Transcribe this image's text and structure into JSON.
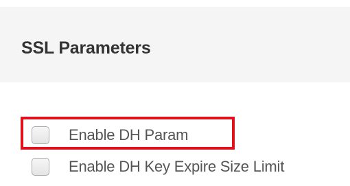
{
  "section": {
    "title": "SSL Parameters"
  },
  "options": [
    {
      "label": "Enable DH Param",
      "checked": false
    },
    {
      "label": "Enable DH Key Expire Size Limit",
      "checked": false
    }
  ],
  "colors": {
    "header_bg": "#f5f5f5",
    "title_text": "#333333",
    "label_text": "#555555",
    "highlight": "#e0101c"
  }
}
